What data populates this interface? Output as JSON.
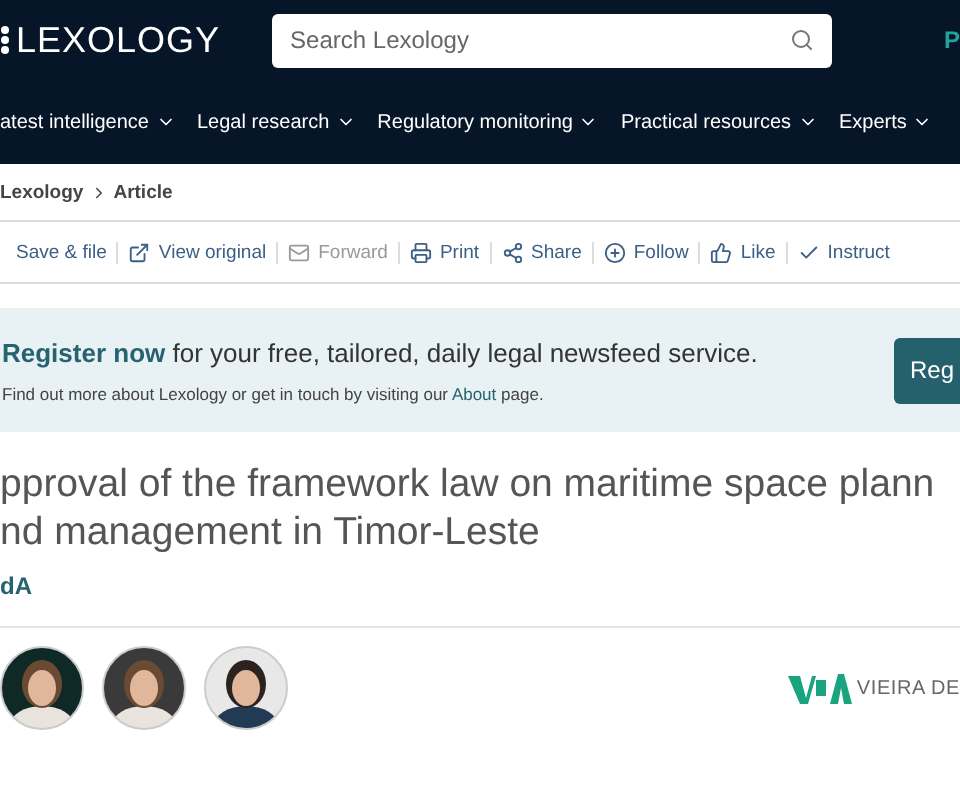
{
  "header": {
    "logo": "LEXOLOGY",
    "search": {
      "placeholder": "Search Lexology"
    },
    "corner_link": "P"
  },
  "nav": [
    {
      "label": "atest intelligence"
    },
    {
      "label": "Legal research"
    },
    {
      "label": "Regulatory monitoring"
    },
    {
      "label": "Practical resources"
    },
    {
      "label": "Experts"
    }
  ],
  "breadcrumb": [
    "Lexology",
    "Article"
  ],
  "toolbar": [
    {
      "label": "Save & file",
      "kind": "none",
      "disabled": false
    },
    {
      "label": "View original",
      "kind": "external",
      "disabled": false
    },
    {
      "label": "Forward",
      "kind": "mail",
      "disabled": true
    },
    {
      "label": "Print",
      "kind": "print",
      "disabled": false
    },
    {
      "label": "Share",
      "kind": "share",
      "disabled": false
    },
    {
      "label": "Follow",
      "kind": "follow",
      "disabled": false
    },
    {
      "label": "Like",
      "kind": "like",
      "disabled": false
    },
    {
      "label": "Instruct",
      "kind": "check",
      "disabled": false
    }
  ],
  "banner": {
    "headline": "**Register now** for your free, tailored, daily legal newsfeed service.",
    "note_before": "Find out more about Lexology or get in touch by visiting our",
    "note_link": "About",
    "note_after": "page.",
    "button": "Reg"
  },
  "article": {
    "title_lines": [
      "pproval of the framework law on maritime space plann",
      "nd management in Timor-Leste"
    ],
    "firm": "dA"
  },
  "avatars": [
    {
      "kind": "picture"
    },
    {
      "kind": "picture"
    },
    {
      "kind": "picture"
    }
  ],
  "firm_logo": {
    "text": "VIEIRA DE"
  }
}
